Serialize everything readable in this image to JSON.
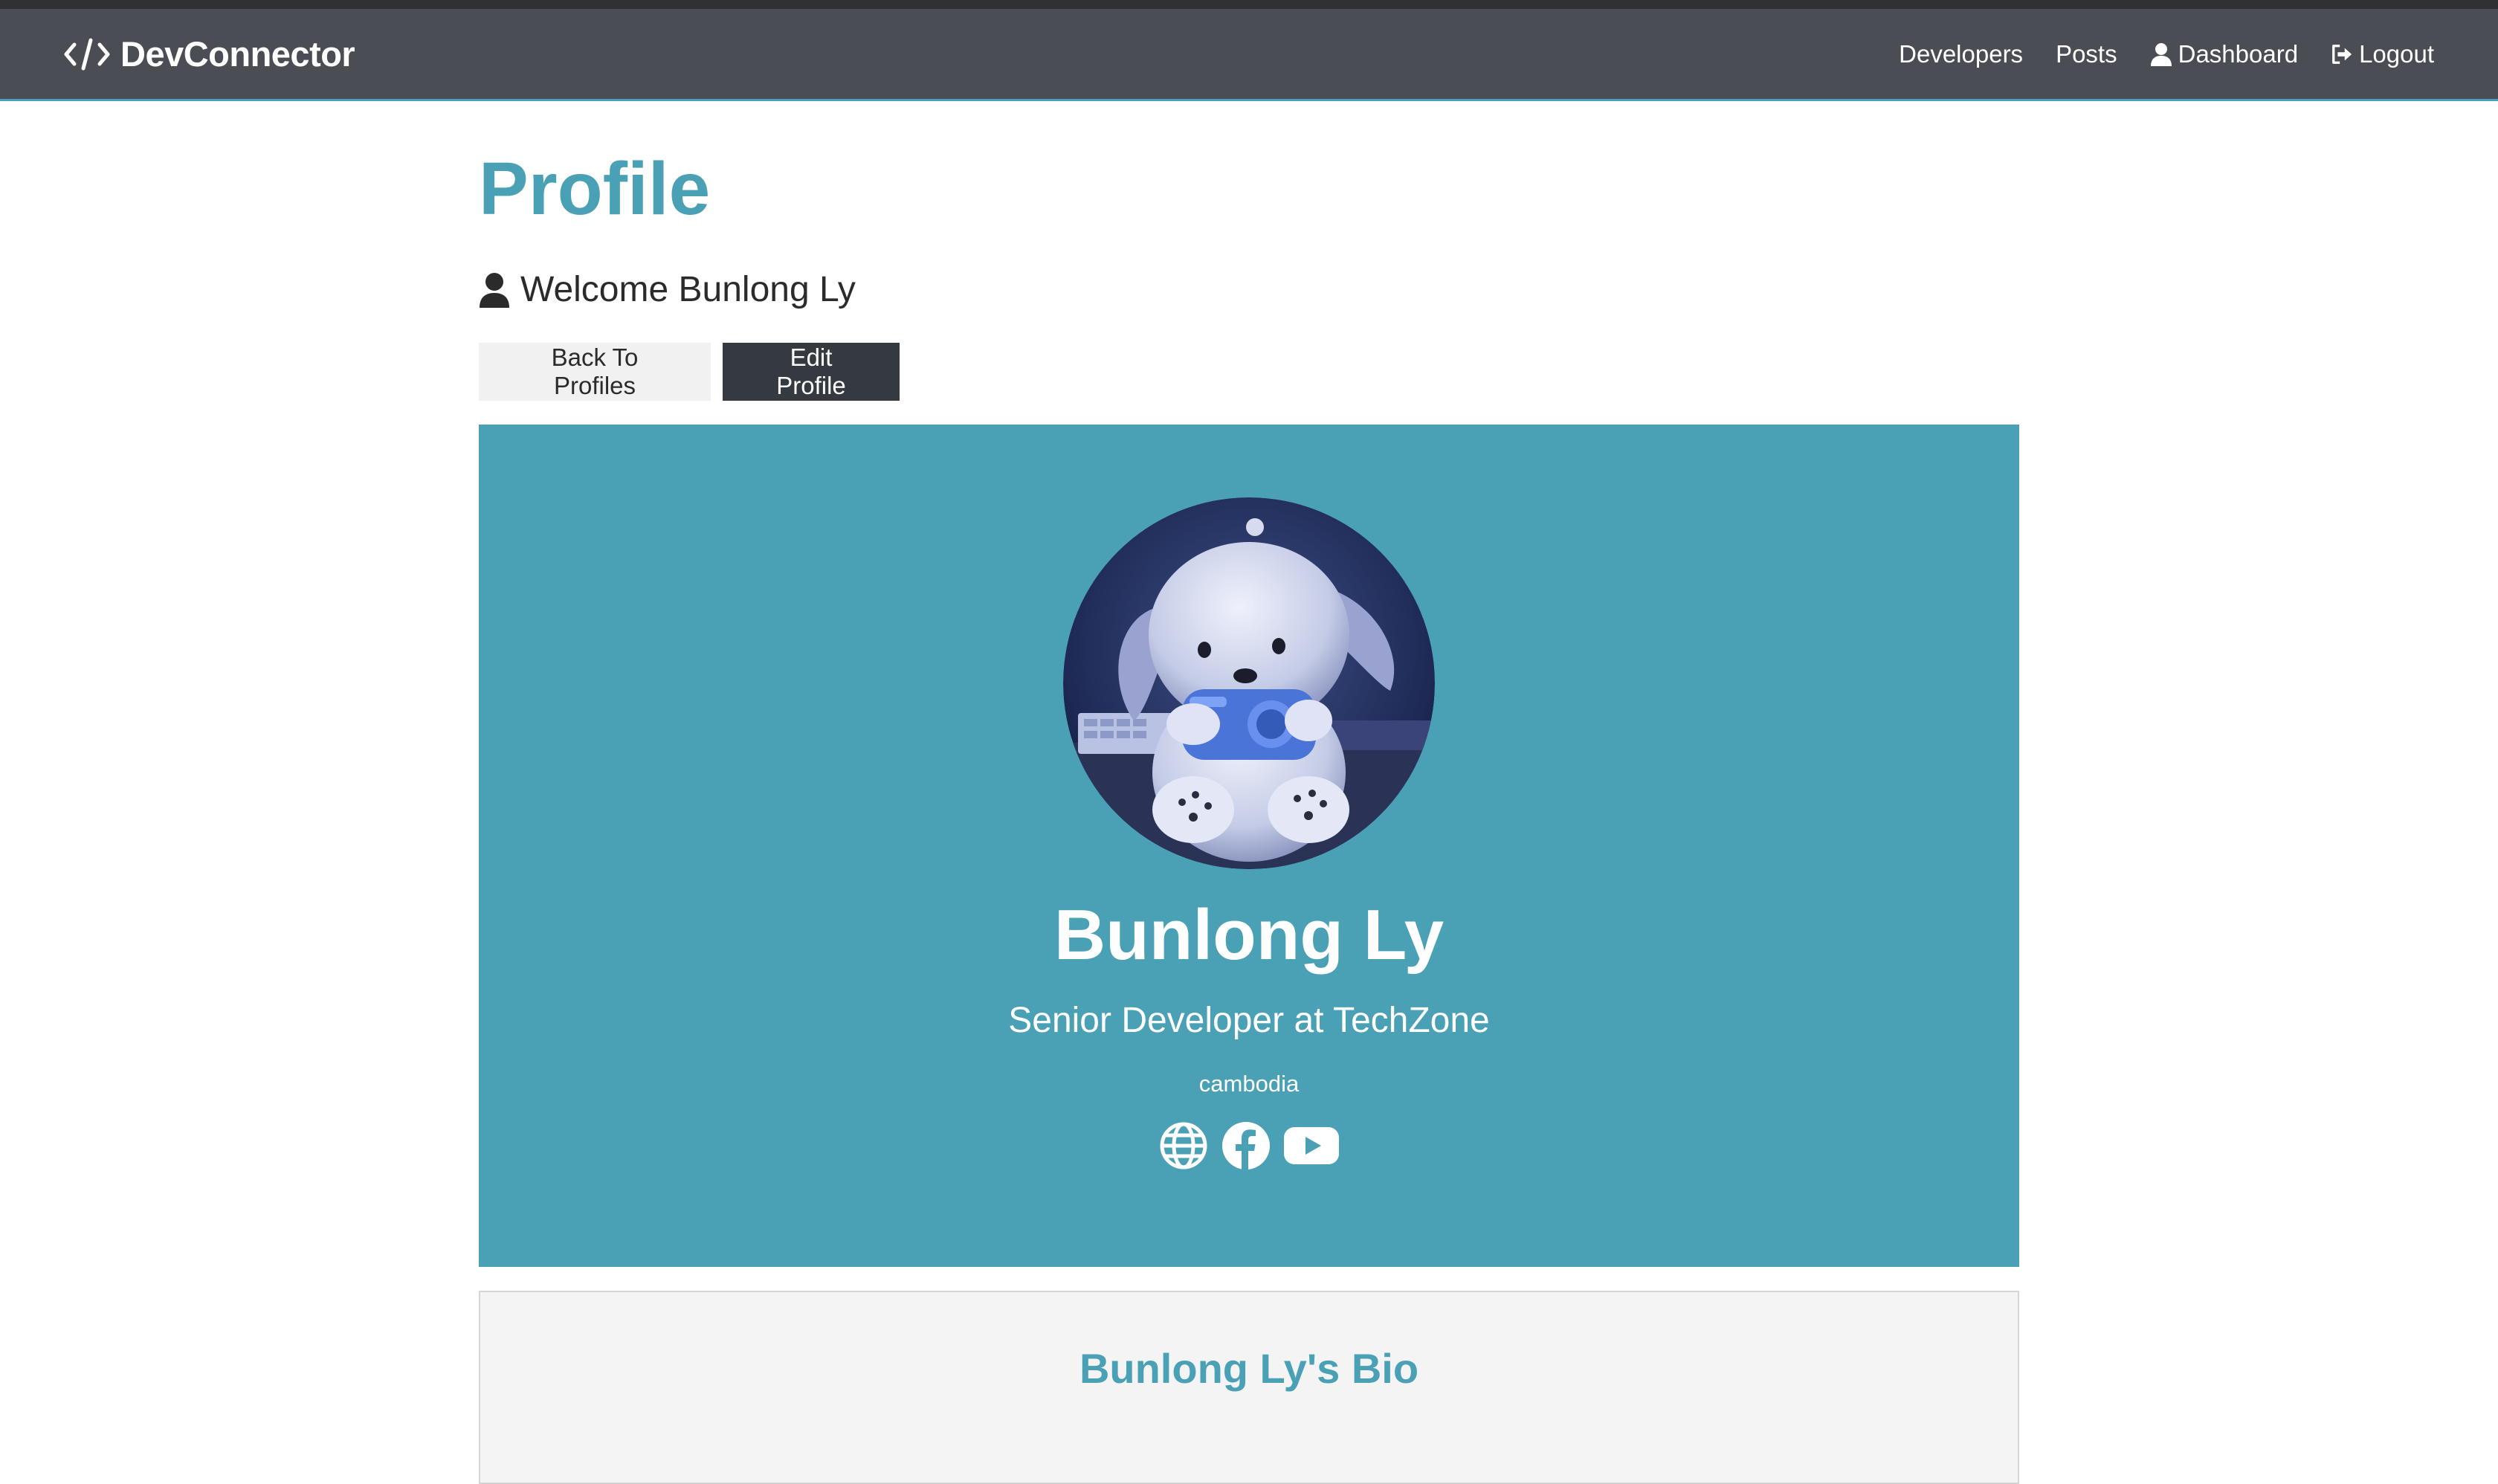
{
  "navbar": {
    "brand": "DevConnector",
    "links": [
      {
        "label": "Developers",
        "icon": null
      },
      {
        "label": "Posts",
        "icon": null
      },
      {
        "label": "Dashboard",
        "icon": "user-icon"
      },
      {
        "label": "Logout",
        "icon": "sign-out-icon"
      }
    ]
  },
  "page": {
    "title": "Profile",
    "welcome": "Welcome Bunlong Ly"
  },
  "buttons": {
    "back": "Back To Profiles",
    "edit": "Edit Profile"
  },
  "profile": {
    "name": "Bunlong Ly",
    "status": "Senior Developer at TechZone",
    "location": "cambodia",
    "avatar_subject": "plush toy dog holding a blue camera",
    "social": [
      "globe-icon",
      "facebook-icon",
      "youtube-icon"
    ]
  },
  "about": {
    "title": "Bunlong Ly's Bio"
  },
  "colors": {
    "primary": "#4aa0b5",
    "navbar": "#4a4d54",
    "dark": "#343a40",
    "light": "#f1f1f1"
  }
}
